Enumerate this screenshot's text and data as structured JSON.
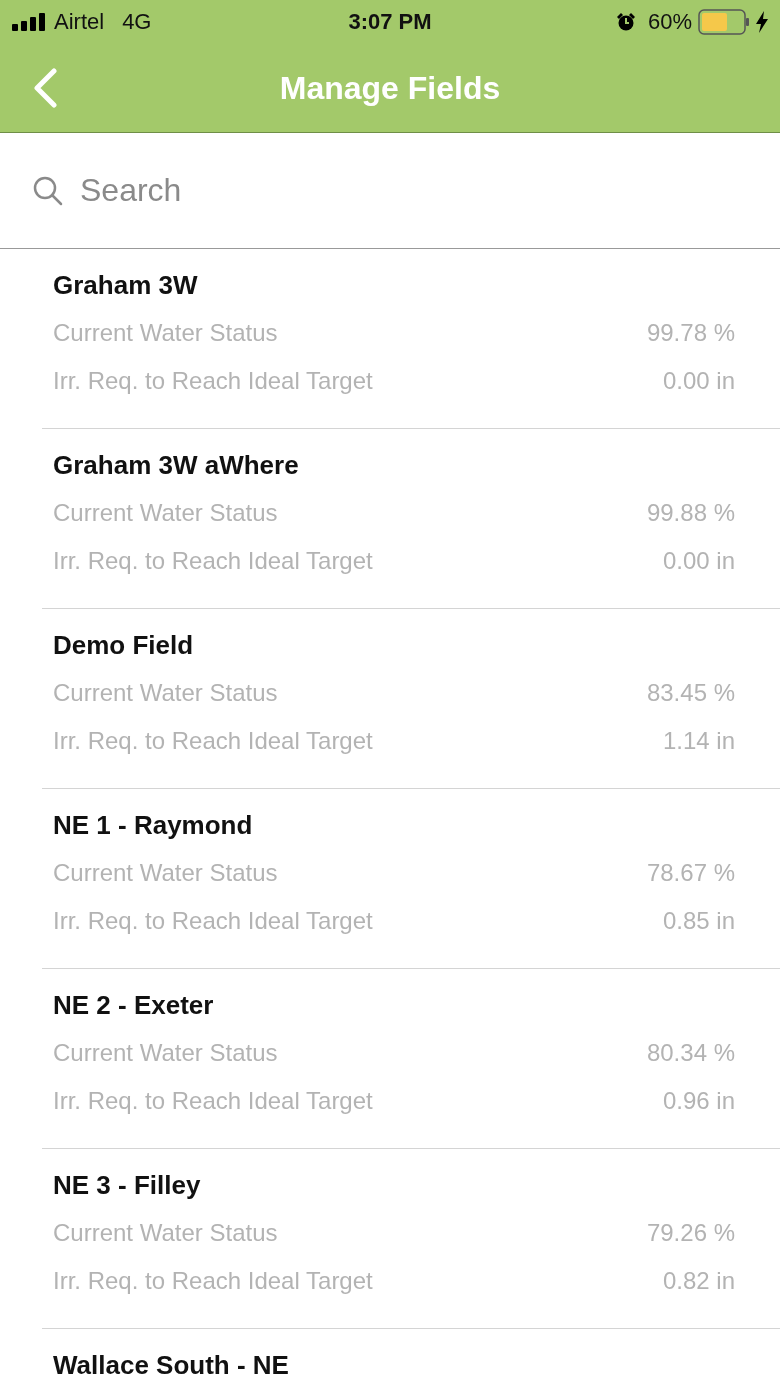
{
  "status_bar": {
    "carrier": "Airtel",
    "network": "4G",
    "time": "3:07 PM",
    "battery": "60%"
  },
  "nav": {
    "title": "Manage Fields"
  },
  "search": {
    "placeholder": "Search"
  },
  "fields": [
    {
      "name": "Graham 3W",
      "metrics": [
        {
          "label": "Current Water Status",
          "value": "99.78 %"
        },
        {
          "label": "Irr. Req. to Reach Ideal Target",
          "value": "0.00 in"
        }
      ]
    },
    {
      "name": "Graham 3W aWhere",
      "metrics": [
        {
          "label": "Current Water Status",
          "value": "99.88 %"
        },
        {
          "label": "Irr. Req. to Reach Ideal Target",
          "value": "0.00 in"
        }
      ]
    },
    {
      "name": "Demo Field",
      "metrics": [
        {
          "label": "Current Water Status",
          "value": "83.45 %"
        },
        {
          "label": "Irr. Req. to Reach Ideal Target",
          "value": "1.14 in"
        }
      ]
    },
    {
      "name": "NE 1 - Raymond",
      "metrics": [
        {
          "label": "Current Water Status",
          "value": "78.67 %"
        },
        {
          "label": "Irr. Req. to Reach Ideal Target",
          "value": "0.85 in"
        }
      ]
    },
    {
      "name": "NE 2 - Exeter",
      "metrics": [
        {
          "label": "Current Water Status",
          "value": "80.34 %"
        },
        {
          "label": "Irr. Req. to Reach Ideal Target",
          "value": "0.96 in"
        }
      ]
    },
    {
      "name": "NE 3 - Filley",
      "metrics": [
        {
          "label": "Current Water Status",
          "value": "79.26 %"
        },
        {
          "label": "Irr. Req. to Reach Ideal Target",
          "value": "0.82 in"
        }
      ]
    },
    {
      "name": "Wallace South - NE"
    }
  ]
}
